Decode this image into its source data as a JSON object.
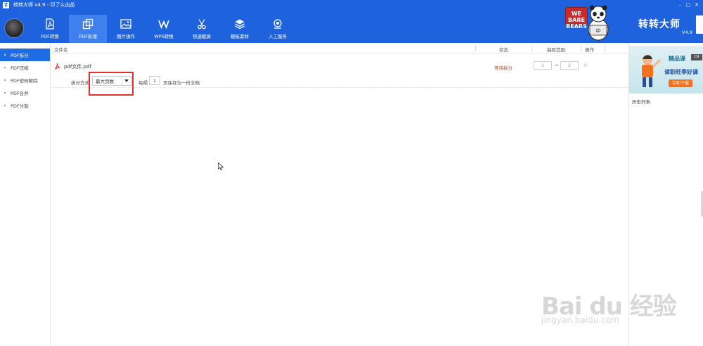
{
  "app": {
    "title": "转转大师 v4.9 - 印了么出品",
    "brand": "转转大师",
    "version": "V4.9",
    "accent_color": "#1e63dd"
  },
  "window_controls": [
    "minimize-icon",
    "maximize-icon",
    "close-icon"
  ],
  "nav": [
    {
      "label": "PDF转换",
      "icon": "pdf-icon"
    },
    {
      "label": "PDF处理",
      "icon": "pdf-process-icon",
      "active": true
    },
    {
      "label": "图片操作",
      "icon": "image-icon"
    },
    {
      "label": "WPS转换",
      "icon": "wps-icon"
    },
    {
      "label": "快速截屏",
      "icon": "scissors-icon"
    },
    {
      "label": "模板素材",
      "icon": "layers-icon"
    },
    {
      "label": "人工服务",
      "icon": "support-icon"
    }
  ],
  "promo": {
    "sign_text": "WE BARE BEARS",
    "sign_sub": "中"
  },
  "sidebar": {
    "items": [
      {
        "label": "PDF拆分",
        "active": true
      },
      {
        "label": "PDF压缩"
      },
      {
        "label": "PDF密码解除"
      },
      {
        "label": "PDF合并"
      },
      {
        "label": "PDF分割"
      }
    ]
  },
  "table": {
    "headers": {
      "name": "文件名",
      "status": "状态",
      "range": "抽取范围",
      "action": "操作"
    },
    "rows": [
      {
        "file_name": "pdf文件.pdf",
        "status": "等待拆分",
        "range_from": "1",
        "range_to": "2",
        "range_arrow": "→",
        "delete": "×"
      }
    ]
  },
  "split": {
    "method_label": "拆分方式",
    "method_value": "最大页数",
    "every_label": "每隔",
    "every_value": "1",
    "pages_label": "页保存为一份文档"
  },
  "right_panel": {
    "ad_close": "CR",
    "ad_title1": "精品课",
    "ad_title2": "读职旺季好课",
    "ad_button": "立即下载",
    "history_label": "历史列表"
  },
  "watermark": {
    "text": "Bai du 经验",
    "url": "jingyan.baidu.com"
  }
}
